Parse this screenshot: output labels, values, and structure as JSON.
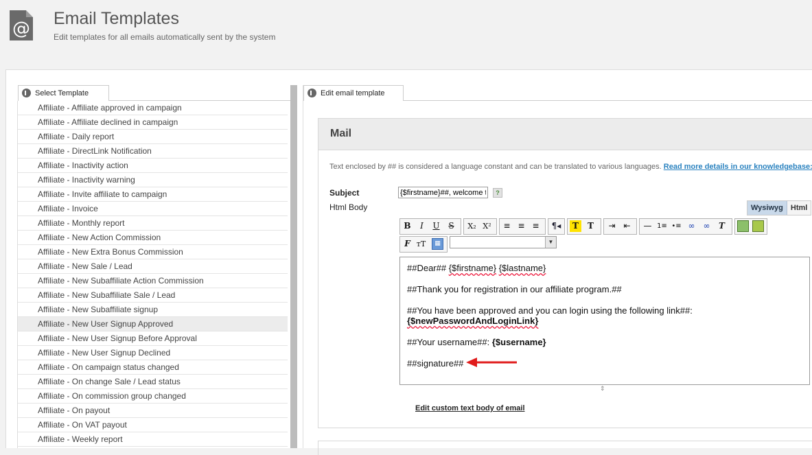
{
  "header": {
    "title": "Email Templates",
    "subtitle": "Edit templates for all emails automatically sent by the system",
    "icon": "email-at-icon"
  },
  "left_panel": {
    "tab_label": "Select Template",
    "items": [
      "Affiliate - Affiliate approved in campaign",
      "Affiliate - Affiliate declined in campaign",
      "Affiliate - Daily report",
      "Affiliate - DirectLink Notification",
      "Affiliate - Inactivity action",
      "Affiliate - Inactivity warning",
      "Affiliate - Invite affiliate to campaign",
      "Affiliate - Invoice",
      "Affiliate - Monthly report",
      "Affiliate - New Action Commission",
      "Affiliate - New Extra Bonus Commission",
      "Affiliate - New Sale / Lead",
      "Affiliate - New Subaffiliate Action Commission",
      "Affiliate - New Subaffiliate Sale / Lead",
      "Affiliate - New Subaffiliate signup",
      "Affiliate - New User Signup Approved",
      "Affiliate - New User Signup Before Approval",
      "Affiliate - New User Signup Declined",
      "Affiliate - On campaign status changed",
      "Affiliate - On change Sale / Lead status",
      "Affiliate - On commission group changed",
      "Affiliate - On payout",
      "Affiliate - On VAT payout",
      "Affiliate - Weekly report"
    ],
    "selected_index": 15
  },
  "right_panel": {
    "tab_label": "Edit email template",
    "section_title": "Mail",
    "info_text": "Text enclosed by ## is considered a language constant and can be translated to various languages.",
    "info_link": "Read more details in our knowledgebase:",
    "subject_label": "Subject",
    "subject_value": "{$firstname}##, welcome to",
    "help_label": "?",
    "body_label": "Html Body",
    "mode_wysiwyg": "Wysiwyg",
    "mode_html": "Html",
    "font_select_value": "",
    "editor": {
      "line1_a": "##Dear## ",
      "line1_var1": "{$firstname}",
      "line1_sp": " ",
      "line1_var2": "{$lastname}",
      "line2": "##Thank you for registration in our affiliate program.##",
      "line3": "##You have been approved and you can login using the following link##:",
      "line4": "{$newPasswordAndLoginLink}",
      "line5_a": "##Your username##: ",
      "line5_b": "{$username}",
      "line6": "##signature##"
    },
    "edit_custom_link": "Edit custom text body of email"
  },
  "colors": {
    "arrow": "#e01b1b",
    "link": "#2a82bf",
    "wysiwyg_active": "#c9d9ea"
  }
}
